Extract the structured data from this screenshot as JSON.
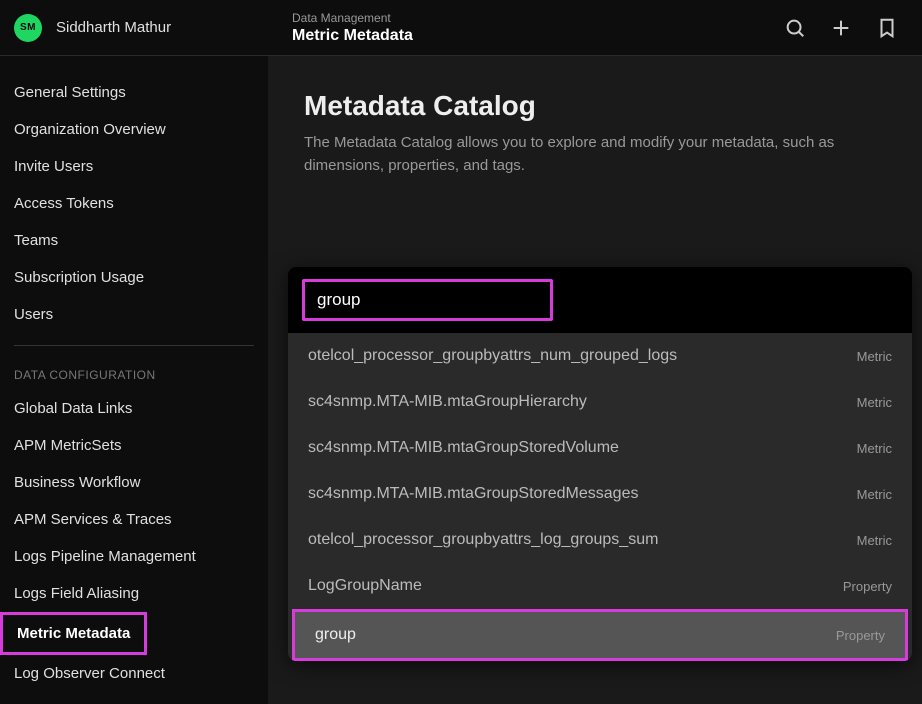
{
  "user": {
    "initials": "SM",
    "name": "Siddharth Mathur"
  },
  "header": {
    "breadcrumb": "Data Management",
    "title": "Metric Metadata"
  },
  "sidebar": {
    "top_items": [
      "General Settings",
      "Organization Overview",
      "Invite Users",
      "Access Tokens",
      "Teams",
      "Subscription Usage",
      "Users"
    ],
    "section_label": "DATA CONFIGURATION",
    "config_items": [
      "Global Data Links",
      "APM MetricSets",
      "Business Workflow",
      "APM Services & Traces",
      "Logs Pipeline Management",
      "Logs Field Aliasing",
      "Metric Metadata",
      "Log Observer Connect"
    ],
    "active_index": 6
  },
  "content": {
    "title": "Metadata Catalog",
    "description": "The Metadata Catalog allows you to explore and modify your metadata, such as dimensions, properties, and tags."
  },
  "search": {
    "value": "group",
    "results": [
      {
        "name": "otelcol_processor_groupbyattrs_num_grouped_logs",
        "type": "Metric"
      },
      {
        "name": "sc4snmp.MTA-MIB.mtaGroupHierarchy",
        "type": "Metric"
      },
      {
        "name": "sc4snmp.MTA-MIB.mtaGroupStoredVolume",
        "type": "Metric"
      },
      {
        "name": "sc4snmp.MTA-MIB.mtaGroupStoredMessages",
        "type": "Metric"
      },
      {
        "name": "otelcol_processor_groupbyattrs_log_groups_sum",
        "type": "Metric"
      },
      {
        "name": "LogGroupName",
        "type": "Property"
      },
      {
        "name": "group",
        "type": "Property"
      }
    ],
    "highlighted_index": 6
  }
}
